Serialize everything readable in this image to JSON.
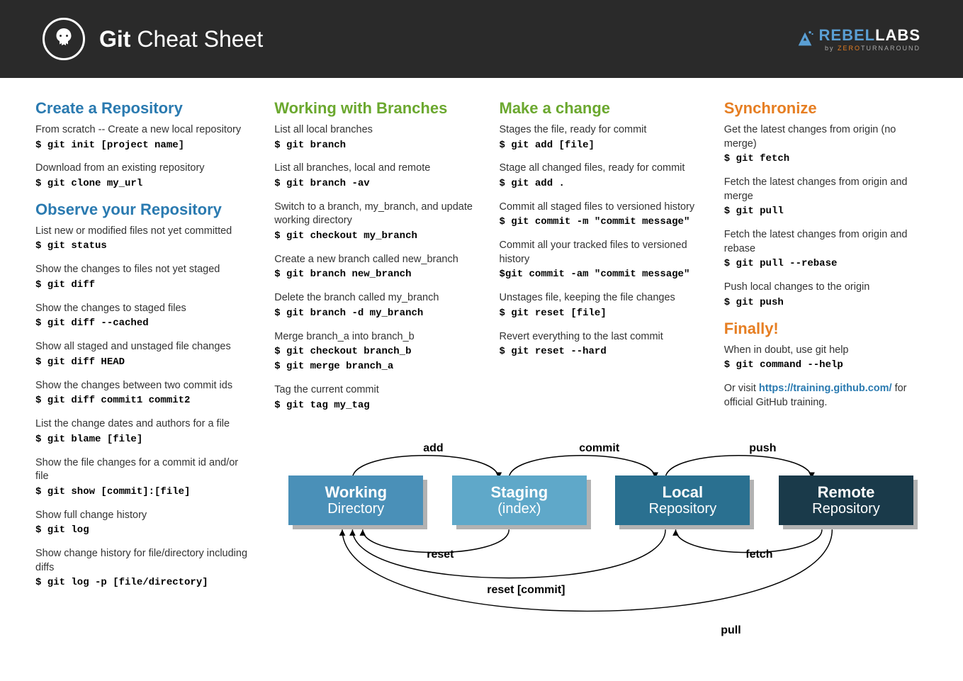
{
  "header": {
    "title_bold": "Git",
    "title_light": " Cheat Sheet",
    "logo_brand_a": "REBEL",
    "logo_brand_b": "LABS",
    "logo_sub_a": "by ",
    "logo_sub_b": "ZERO",
    "logo_sub_c": "TURNAROUND"
  },
  "col1": {
    "h1": "Create a Repository",
    "i1d": "From scratch -- Create a new local repository",
    "i1c": "$ git init [project name]",
    "i2d": "Download from an existing repository",
    "i2c": "$ git clone my_url",
    "h2": "Observe your Repository",
    "i3d": "List new or modified files not yet committed",
    "i3c": "$ git status",
    "i4d": "Show the changes to files not yet staged",
    "i4c": "$ git diff",
    "i5d": "Show the changes to staged files",
    "i5c": "$ git diff --cached",
    "i6d": "Show all staged and unstaged file changes",
    "i6c": "$ git diff HEAD",
    "i7d": "Show the changes between two commit ids",
    "i7c": "$ git diff commit1 commit2",
    "i8d": "List the change dates and authors for a file",
    "i8c": "$ git blame [file]",
    "i9d": "Show the file changes for a commit id and/or file",
    "i9c": "$ git show [commit]:[file]",
    "i10d": "Show full change history",
    "i10c": "$ git log",
    "i11d": "Show change history for file/directory including diffs",
    "i11c": "$ git log -p [file/directory]"
  },
  "col2": {
    "h1": "Working with Branches",
    "i1d": "List all local branches",
    "i1c": "$ git branch",
    "i2d": "List all branches, local and remote",
    "i2c": "$ git branch -av",
    "i3d": "Switch to a branch, my_branch, and update working directory",
    "i3c": "$ git checkout my_branch",
    "i4d": "Create a new branch called new_branch",
    "i4c": "$ git branch new_branch",
    "i5d": "Delete the branch called my_branch",
    "i5c": "$ git branch -d my_branch",
    "i6d": "Merge branch_a into branch_b",
    "i6c": "$ git checkout branch_b",
    "i6c2": "$ git merge branch_a",
    "i7d": "Tag the current commit",
    "i7c": "$ git tag my_tag"
  },
  "col3": {
    "h1": "Make a change",
    "i1d": "Stages the file, ready for commit",
    "i1c": "$ git add [file]",
    "i2d": "Stage all changed files, ready for commit",
    "i2c": "$ git add .",
    "i3d": "Commit all staged files to versioned history",
    "i3c": "$ git commit -m \"commit message\"",
    "i4d": "Commit all your tracked files to versioned history",
    "i4c": "$git commit -am \"commit message\"",
    "i5d": "Unstages file, keeping the file changes",
    "i5c": "$ git reset [file]",
    "i6d": "Revert everything to the last commit",
    "i6c": "$ git reset --hard"
  },
  "col4": {
    "h1": "Synchronize",
    "i1d": "Get the latest changes from origin (no merge)",
    "i1c": "$ git fetch",
    "i2d": "Fetch the latest changes from origin and merge",
    "i2c": "$ git pull",
    "i3d": "Fetch the latest changes from origin and rebase",
    "i3c": "$ git pull --rebase",
    "i4d": "Push local changes to the origin",
    "i4c": "$ git push",
    "h2": "Finally!",
    "i5d": "When in doubt, use git help",
    "i5c": "$ git command --help",
    "i6d1": "Or visit ",
    "i6link": "https://training.github.com/",
    "i6d2": " for official GitHub training."
  },
  "diagram": {
    "b1a": "Working",
    "b1b": "Directory",
    "b2a": "Staging",
    "b2b": "(index)",
    "b3a": "Local",
    "b3b": "Repository",
    "b4a": "Remote",
    "b4b": "Repository",
    "l_add": "add",
    "l_commit": "commit",
    "l_push": "push",
    "l_reset": "reset",
    "l_fetch": "fetch",
    "l_resetc": "reset [commit]",
    "l_pull": "pull"
  }
}
